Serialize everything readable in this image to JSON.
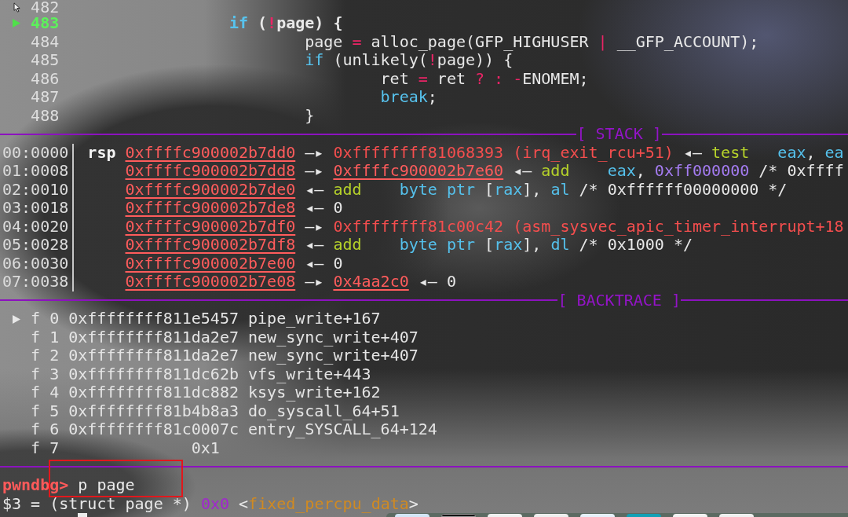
{
  "source": {
    "lines": [
      {
        "number": "482",
        "current": false
      },
      {
        "number": "483",
        "current": true,
        "code": [
          {
            "kind": "keyword",
            "text": "\t\t\tif"
          },
          {
            "kind": "plain",
            "text": " ("
          },
          {
            "kind": "operator",
            "text": "!"
          },
          {
            "kind": "plain",
            "text": "page) {"
          }
        ]
      },
      {
        "number": "484",
        "current": false,
        "code": [
          {
            "kind": "plain",
            "text": "\t\t\t\tpage "
          },
          {
            "kind": "operator",
            "text": "="
          },
          {
            "kind": "plain",
            "text": " alloc_page(GFP_HIGHUSER "
          },
          {
            "kind": "operator",
            "text": "|"
          },
          {
            "kind": "plain",
            "text": " __GFP_ACCOUNT);"
          }
        ]
      },
      {
        "number": "485",
        "current": false,
        "code": [
          {
            "kind": "keyword",
            "text": "\t\t\t\tif"
          },
          {
            "kind": "plain",
            "text": " (unlikely("
          },
          {
            "kind": "operator",
            "text": "!"
          },
          {
            "kind": "plain",
            "text": "page)) {"
          }
        ]
      },
      {
        "number": "486",
        "current": false,
        "code": [
          {
            "kind": "plain",
            "text": "\t\t\t\t\tret "
          },
          {
            "kind": "operator",
            "text": "="
          },
          {
            "kind": "plain",
            "text": " ret "
          },
          {
            "kind": "operator",
            "text": "? : -"
          },
          {
            "kind": "plain",
            "text": "ENOMEM;"
          }
        ]
      },
      {
        "number": "487",
        "current": false,
        "code": [
          {
            "kind": "keyword",
            "text": "\t\t\t\t\tbreak"
          },
          {
            "kind": "plain",
            "text": ";"
          }
        ]
      },
      {
        "number": "488",
        "current": false,
        "code": [
          {
            "kind": "plain",
            "text": "\t\t\t\t}"
          }
        ]
      }
    ]
  },
  "stack": {
    "title": "[ STACK ]",
    "rows": [
      {
        "offset": "00:0000",
        "register": "rsp",
        "entry": [
          {
            "kind": "address",
            "text": "0xffffc900002b7dd0"
          },
          {
            "kind": "plain",
            "text": " —▸ "
          },
          {
            "kind": "code",
            "text": "0xffffffff81068393 (irq_exit_rcu+51)"
          },
          {
            "kind": "plain",
            "text": " ◂— "
          },
          {
            "kind": "mnemonic",
            "text": "test   "
          },
          {
            "kind": "register",
            "text": "eax"
          },
          {
            "kind": "plain",
            "text": ", "
          },
          {
            "kind": "register",
            "text": "ea"
          }
        ]
      },
      {
        "offset": "01:0008",
        "entry": [
          {
            "kind": "address",
            "text": "0xffffc900002b7dd8"
          },
          {
            "kind": "plain",
            "text": " —▸ "
          },
          {
            "kind": "address",
            "text": "0xffffc900002b7e60"
          },
          {
            "kind": "plain",
            "text": " ◂— "
          },
          {
            "kind": "mnemonic",
            "text": "add    "
          },
          {
            "kind": "register",
            "text": "eax"
          },
          {
            "kind": "plain",
            "text": ", "
          },
          {
            "kind": "immediate",
            "text": "0xff000000"
          },
          {
            "kind": "plain",
            "text": " /* 0xffff"
          }
        ]
      },
      {
        "offset": "02:0010",
        "entry": [
          {
            "kind": "address",
            "text": "0xffffc900002b7de0"
          },
          {
            "kind": "plain",
            "text": " ◂— "
          },
          {
            "kind": "mnemonic",
            "text": "add    "
          },
          {
            "kind": "register",
            "text": "byte ptr"
          },
          {
            "kind": "plain",
            "text": " ["
          },
          {
            "kind": "register",
            "text": "rax"
          },
          {
            "kind": "plain",
            "text": "], "
          },
          {
            "kind": "register",
            "text": "al"
          },
          {
            "kind": "plain",
            "text": " /* 0xffffff00000000 */"
          }
        ]
      },
      {
        "offset": "03:0018",
        "entry": [
          {
            "kind": "address",
            "text": "0xffffc900002b7de8"
          },
          {
            "kind": "plain",
            "text": " ◂— 0"
          }
        ]
      },
      {
        "offset": "04:0020",
        "entry": [
          {
            "kind": "address",
            "text": "0xffffc900002b7df0"
          },
          {
            "kind": "plain",
            "text": " —▸ "
          },
          {
            "kind": "code",
            "text": "0xffffffff81c00c42 (asm_sysvec_apic_timer_interrupt+18"
          }
        ]
      },
      {
        "offset": "05:0028",
        "entry": [
          {
            "kind": "address",
            "text": "0xffffc900002b7df8"
          },
          {
            "kind": "plain",
            "text": " ◂— "
          },
          {
            "kind": "mnemonic",
            "text": "add    "
          },
          {
            "kind": "register",
            "text": "byte ptr"
          },
          {
            "kind": "plain",
            "text": " ["
          },
          {
            "kind": "register",
            "text": "rax"
          },
          {
            "kind": "plain",
            "text": "], "
          },
          {
            "kind": "register",
            "text": "dl"
          },
          {
            "kind": "plain",
            "text": " /* 0x1000 */"
          }
        ]
      },
      {
        "offset": "06:0030",
        "entry": [
          {
            "kind": "address",
            "text": "0xffffc900002b7e00"
          },
          {
            "kind": "plain",
            "text": " ◂— 0"
          }
        ]
      },
      {
        "offset": "07:0038",
        "entry": [
          {
            "kind": "address",
            "text": "0xffffc900002b7e08"
          },
          {
            "kind": "plain",
            "text": " —▸ "
          },
          {
            "kind": "address",
            "text": "0x4aa2c0"
          },
          {
            "kind": "plain",
            "text": " ◂— 0"
          }
        ]
      }
    ]
  },
  "backtrace": {
    "title": "[ BACKTRACE ]",
    "frames": [
      {
        "selected": true,
        "frame": "f 0",
        "address": "0xffffffff811e5457",
        "symbol": "pipe_write+167"
      },
      {
        "selected": false,
        "frame": "f 1",
        "address": "0xffffffff811da2e7",
        "symbol": "new_sync_write+407"
      },
      {
        "selected": false,
        "frame": "f 2",
        "address": "0xffffffff811da2e7",
        "symbol": "new_sync_write+407"
      },
      {
        "selected": false,
        "frame": "f 3",
        "address": "0xffffffff811dc62b",
        "symbol": "vfs_write+443"
      },
      {
        "selected": false,
        "frame": "f 4",
        "address": "0xffffffff811dc882",
        "symbol": "ksys_write+162"
      },
      {
        "selected": false,
        "frame": "f 5",
        "address": "0xffffffff81b4b8a3",
        "symbol": "do_syscall_64+51"
      },
      {
        "selected": false,
        "frame": "f 6",
        "address": "0xffffffff81c0007c",
        "symbol": "entry_SYSCALL_64+124"
      },
      {
        "selected": false,
        "frame": "f 7",
        "address": "0x1"
      }
    ]
  },
  "command": {
    "prompt": "pwndbg>",
    "input": "p page"
  },
  "output": [
    {
      "kind": "plain",
      "text": "$3 = (struct page *) "
    },
    {
      "kind": "number",
      "text": "0x0"
    },
    {
      "kind": "plain",
      "text": " <"
    },
    {
      "kind": "symbol",
      "text": "fixed_percpu_data"
    },
    {
      "kind": "plain",
      "text": ">"
    }
  ]
}
